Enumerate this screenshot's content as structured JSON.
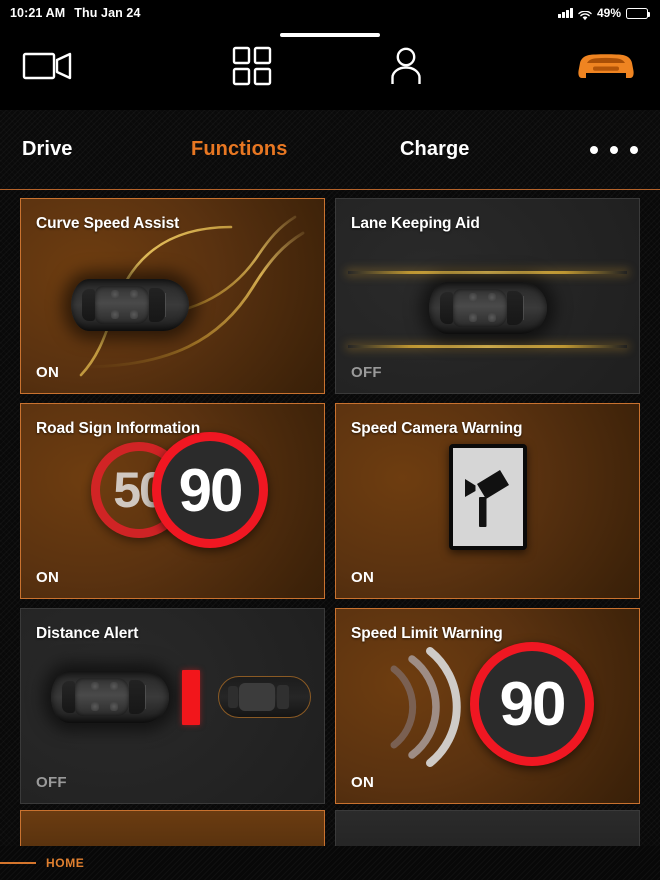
{
  "status_bar": {
    "time": "10:21 AM",
    "date": "Thu Jan 24",
    "battery_percent": "49%",
    "signal_icon": "cellular-bars-icon",
    "wifi_icon": "wifi-icon",
    "battery_icon": "battery-icon"
  },
  "top_nav": {
    "items": [
      {
        "name": "camera",
        "icon": "video-camera-icon"
      },
      {
        "name": "apps",
        "icon": "grid-apps-icon"
      },
      {
        "name": "profile",
        "icon": "person-icon"
      },
      {
        "name": "vehicle",
        "icon": "car-front-icon"
      }
    ]
  },
  "tabs": {
    "drive": "Drive",
    "functions": "Functions",
    "charge": "Charge",
    "more_icon": "more-dots-icon",
    "active": "Functions",
    "accent_color": "#e87722"
  },
  "cards": [
    {
      "title": "Curve Speed Assist",
      "state": "ON",
      "enabled": true,
      "art": "car-with-curve-lanes"
    },
    {
      "title": "Lane Keeping Aid",
      "state": "OFF",
      "enabled": false,
      "art": "car-between-lane-lines"
    },
    {
      "title": "Road Sign Information",
      "state": "ON",
      "enabled": true,
      "art": "two-speed-limit-signs",
      "sign_back_value": "50",
      "sign_front_value": "90"
    },
    {
      "title": "Speed Camera Warning",
      "state": "ON",
      "enabled": true,
      "art": "speed-camera-sign"
    },
    {
      "title": "Distance Alert",
      "state": "OFF",
      "enabled": false,
      "art": "two-cars-with-red-gap-bar"
    },
    {
      "title": "Speed Limit Warning",
      "state": "ON",
      "enabled": true,
      "art": "sound-waves-with-speed-sign",
      "sign_value": "90"
    }
  ],
  "footer": {
    "home_label": "HOME",
    "accent_color": "#e08030"
  },
  "colors": {
    "accent_orange": "#e87722",
    "card_on_border": "#c9722f",
    "card_off_border": "#3a3a3a",
    "sign_red": "#f01722",
    "lane_gold": "#f0c85a",
    "alert_red": "#f2161b"
  }
}
